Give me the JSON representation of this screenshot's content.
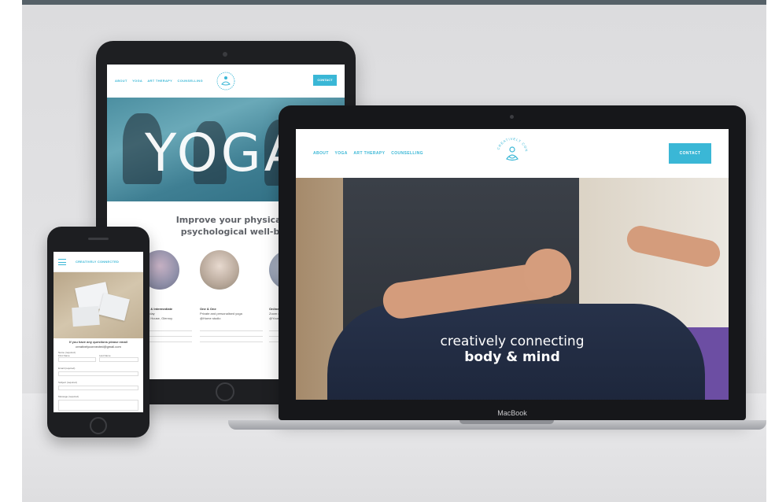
{
  "laptop": {
    "nav_links": [
      "ABOUT",
      "YOGA",
      "ART THERAPY",
      "COUNSELLING"
    ],
    "contact_label": "CONTACT",
    "logo_text": "CREATIVELY CONNECTED",
    "tagline_line1": "creatively connecting",
    "tagline_line2": "body & mind",
    "brand": "MacBook"
  },
  "tablet": {
    "nav_links": [
      "ABOUT",
      "YOGA",
      "ART THERAPY",
      "COUNSELLING"
    ],
    "contact_label": "CONTACT",
    "hero_title": "YOGA",
    "headline": "Improve your physical and psychological well-being",
    "cards": [
      {
        "title": "s & Intermediate",
        "line1": "nday",
        "line2": "e House, Glenroy"
      },
      {
        "title": "One & One",
        "line1": "Private and personalised yoga",
        "line2": "@Home studio"
      },
      {
        "title": "Online",
        "line1": "Zoom c",
        "line2": "@Your"
      }
    ]
  },
  "phone": {
    "brand": "CREATIVELY CONNECTED",
    "question": "If you have any questions please email",
    "email": "creativelyconnected@gmail.com",
    "form_labels": [
      "Name (required)",
      "First Name",
      "Last Name",
      "Email (required)",
      "Subject (required)",
      "Message (required)"
    ]
  },
  "colors": {
    "accent": "#3ab7d6",
    "device_body": "#1e1f22",
    "backdrop": "#dcdcde",
    "topbar": "#566168"
  }
}
